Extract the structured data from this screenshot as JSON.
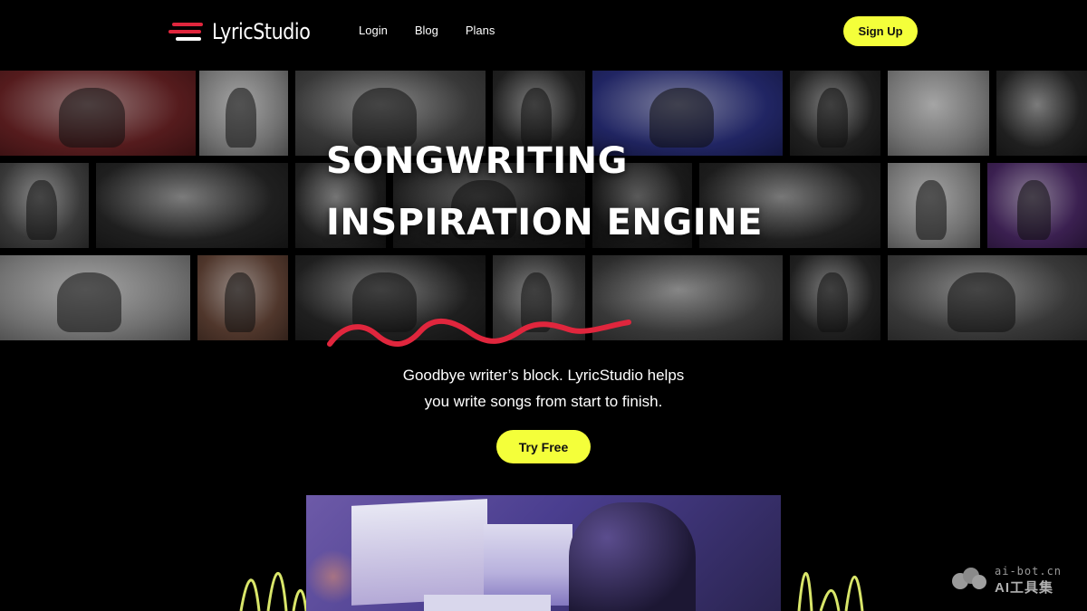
{
  "nav": {
    "brand": "LyricStudio",
    "links": [
      "Login",
      "Blog",
      "Plans"
    ],
    "signup_label": "Sign Up"
  },
  "hero": {
    "title_line1": "SONGWRITING",
    "title_line2": "INSPIRATION ENGINE",
    "accent_color": "#e0263d"
  },
  "body": {
    "tagline_line1": "Goodbye writer’s block. LyricStudio helps",
    "tagline_line2": "you write songs from start to finish.",
    "cta_label": "Try Free"
  },
  "watermark": {
    "small_text": "ai-bot.cn",
    "big_text": "AI工具集"
  },
  "colors": {
    "background": "#000000",
    "button": "#f4ff3a",
    "brand_red": "#e0263d",
    "wave": "#d9e66a"
  }
}
